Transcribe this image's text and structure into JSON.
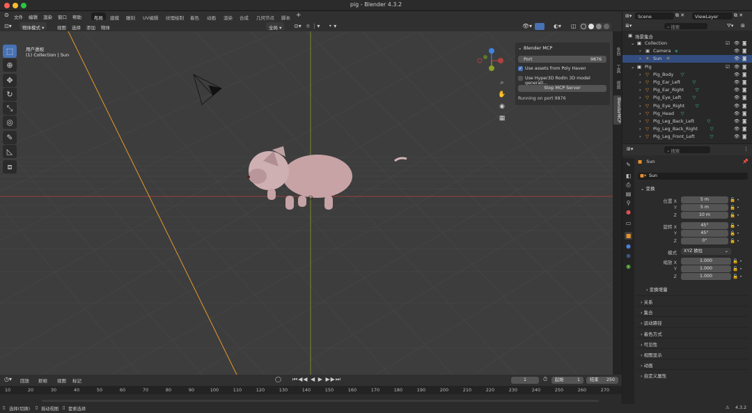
{
  "window": {
    "title": "pig - Blender 4.3.2"
  },
  "menus": [
    "文件",
    "编辑",
    "渲染",
    "窗口",
    "帮助"
  ],
  "workspaces": [
    "布局",
    "建模",
    "雕刻",
    "UV编辑",
    "纹理绘制",
    "着色",
    "动画",
    "渲染",
    "合成",
    "几何节点",
    "脚本"
  ],
  "scene_selector": {
    "label": "Scene",
    "view_layer": "ViewLayer"
  },
  "viewport_header": {
    "mode": "物体模式",
    "menus": [
      "视图",
      "选择",
      "添加",
      "物体"
    ],
    "orientation": "全局",
    "options_label": "选项"
  },
  "viewport": {
    "view_name": "用户透视",
    "collection_info": "(1) Collection | Sun"
  },
  "npanel": {
    "tabs": [
      "条目",
      "工具",
      "视图",
      "BlenderMCP"
    ],
    "title": "Blender MCP",
    "port_label": "Port",
    "port_value": "9876",
    "poly_haven_label": "Use assets from Poly Haven",
    "poly_haven_checked": true,
    "hyper3d_label": "Use Hyper3D Rodin 3D model generati...",
    "hyper3d_checked": false,
    "stop_button": "Stop MCP Server",
    "status": "Running on port 9876"
  },
  "outliner": {
    "search_placeholder": "搜索",
    "root": "场景集合",
    "rows": [
      {
        "name": "Collection",
        "indent": 1,
        "kind": "collection"
      },
      {
        "name": "Camera",
        "indent": 2,
        "kind": "camera"
      },
      {
        "name": "Sun",
        "indent": 2,
        "kind": "light",
        "selected": true
      },
      {
        "name": "Pig",
        "indent": 1,
        "kind": "collection"
      },
      {
        "name": "Pig_Body",
        "indent": 2,
        "kind": "mesh"
      },
      {
        "name": "Pig_Ear_Left",
        "indent": 2,
        "kind": "mesh"
      },
      {
        "name": "Pig_Ear_Right",
        "indent": 2,
        "kind": "mesh"
      },
      {
        "name": "Pig_Eye_Left",
        "indent": 2,
        "kind": "mesh"
      },
      {
        "name": "Pig_Eye_Right",
        "indent": 2,
        "kind": "mesh"
      },
      {
        "name": "Pig_Head",
        "indent": 2,
        "kind": "mesh"
      },
      {
        "name": "Pig_Leg_Back_Left",
        "indent": 2,
        "kind": "mesh"
      },
      {
        "name": "Pig_Leg_Back_Right",
        "indent": 2,
        "kind": "mesh"
      },
      {
        "name": "Pig_Leg_Front_Left",
        "indent": 2,
        "kind": "mesh"
      }
    ]
  },
  "properties": {
    "search_placeholder": "搜索",
    "object_name": "Sun",
    "data_name": "Sun",
    "transform_label": "变换",
    "location_label": "位置 X",
    "location": [
      "5 m",
      "5 m",
      "10 m"
    ],
    "rotation_label": "旋转 X",
    "rotation": [
      "45°",
      "45°",
      "0°"
    ],
    "mode_label": "模式",
    "mode_value": "XYZ 欧拉",
    "scale_label": "缩放 X",
    "scale": [
      "1.000",
      "1.000",
      "1.000"
    ],
    "axis_y": "Y",
    "axis_z": "Z",
    "delta_label": "变换增量",
    "sections": [
      "关系",
      "集合",
      "运动路径",
      "着色方式",
      "可见性",
      "视图显示",
      "动画",
      "自定义属性"
    ]
  },
  "timeline": {
    "menus": [
      "回放",
      "抠帧",
      "视图",
      "标记"
    ],
    "current_frame": "1",
    "start_label": "起始",
    "start": "1",
    "end_label": "结束",
    "end": "250",
    "ticks": [
      "10",
      "20",
      "30",
      "40",
      "50",
      "60",
      "70",
      "80",
      "90",
      "100",
      "110",
      "120",
      "130",
      "140",
      "150",
      "160",
      "170",
      "180",
      "190",
      "200",
      "210",
      "220",
      "230",
      "240",
      "250",
      "260",
      "270"
    ]
  },
  "statusbar": {
    "items": [
      "选择(切换)",
      "摇动视图",
      "套索选择"
    ],
    "version": "4.3.2"
  },
  "colors": {
    "accent": "#4772b3",
    "x_axis": "#b2403f",
    "y_axis": "#8aa028",
    "z_axis": "#3f82e0",
    "selected_row": "#334d80",
    "pig": "#c9a7aa"
  }
}
